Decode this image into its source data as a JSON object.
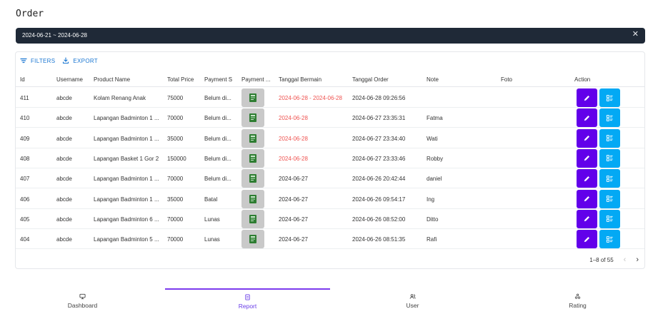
{
  "page": {
    "title": "Order"
  },
  "date_filter": {
    "range_text": "2024-06-21 ~ 2024-06-28",
    "close_glyph": "✕"
  },
  "toolbar": {
    "filters_label": "FILTERS",
    "export_label": "EXPORT"
  },
  "table": {
    "columns": [
      "Id",
      "Username",
      "Product Name",
      "Total Price",
      "Payment S",
      "Payment ...",
      "Tanggal Bermain",
      "Tanggal Order",
      "Note",
      "Foto",
      "Action"
    ],
    "rows": [
      {
        "id": "411",
        "username": "abcde",
        "product": "Kolam Renang Anak",
        "price": "75000",
        "status": "Belum di...",
        "tanggal_bermain": "2024-06-28 - 2024-06-28",
        "bermain_highlight": true,
        "tanggal_order": "2024-06-28 09:26:56",
        "note": "",
        "foto": ""
      },
      {
        "id": "410",
        "username": "abcde",
        "product": "Lapangan Badminton 1 ...",
        "price": "70000",
        "status": "Belum di...",
        "tanggal_bermain": "2024-06-28",
        "bermain_highlight": true,
        "tanggal_order": "2024-06-27 23:35:31",
        "note": "Fatma",
        "foto": ""
      },
      {
        "id": "409",
        "username": "abcde",
        "product": "Lapangan Badminton 1 ...",
        "price": "35000",
        "status": "Belum di...",
        "tanggal_bermain": "2024-06-28",
        "bermain_highlight": true,
        "tanggal_order": "2024-06-27 23:34:40",
        "note": "Wati",
        "foto": ""
      },
      {
        "id": "408",
        "username": "abcde",
        "product": "Lapangan Basket 1 Gor 2",
        "price": "150000",
        "status": "Belum di...",
        "tanggal_bermain": "2024-06-28",
        "bermain_highlight": true,
        "tanggal_order": "2024-06-27 23:33:46",
        "note": "Robby",
        "foto": ""
      },
      {
        "id": "407",
        "username": "abcde",
        "product": "Lapangan Badminton 1 ...",
        "price": "70000",
        "status": "Belum di...",
        "tanggal_bermain": "2024-06-27",
        "bermain_highlight": false,
        "tanggal_order": "2024-06-26 20:42:44",
        "note": "daniel",
        "foto": ""
      },
      {
        "id": "406",
        "username": "abcde",
        "product": "Lapangan Badminton 1 ...",
        "price": "35000",
        "status": "Batal",
        "tanggal_bermain": "2024-06-27",
        "bermain_highlight": false,
        "tanggal_order": "2024-06-26 09:54:17",
        "note": "Ing",
        "foto": ""
      },
      {
        "id": "405",
        "username": "abcde",
        "product": "Lapangan Badminton 6 ...",
        "price": "70000",
        "status": "Lunas",
        "tanggal_bermain": "2024-06-27",
        "bermain_highlight": false,
        "tanggal_order": "2024-06-26 08:52:00",
        "note": "Ditto",
        "foto": ""
      },
      {
        "id": "404",
        "username": "abcde",
        "product": "Lapangan Badminton 5 ...",
        "price": "70000",
        "status": "Lunas",
        "tanggal_bermain": "2024-06-27",
        "bermain_highlight": false,
        "tanggal_order": "2024-06-26 08:51:35",
        "note": "Rafi",
        "foto": ""
      }
    ]
  },
  "pagination": {
    "range_text": "1–8 of 55",
    "prev_glyph": "‹",
    "next_glyph": "›",
    "prev_disabled": true
  },
  "bottom_nav": {
    "items": [
      {
        "label": "Dashboard",
        "icon": "dashboard-icon",
        "active": false
      },
      {
        "label": "Report",
        "icon": "report-icon",
        "active": true
      },
      {
        "label": "User",
        "icon": "users-icon",
        "active": false
      },
      {
        "label": "Rating",
        "icon": "rating-icon",
        "active": false
      }
    ]
  },
  "colors": {
    "date_bar_bg": "#1f2937",
    "edit_button": "#6200ea",
    "detail_button": "#03a9f4",
    "highlight_date": "#ef5350",
    "active_nav": "#6a3de8"
  }
}
